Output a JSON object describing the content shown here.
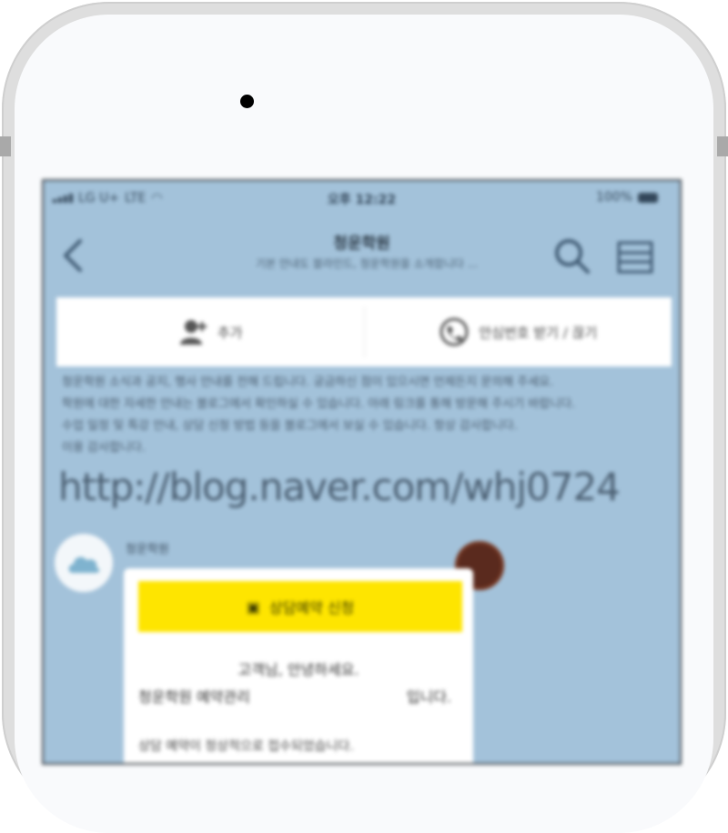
{
  "status": {
    "carrier": "LG U+",
    "network": "LTE",
    "time": "오후 12:22",
    "battery": "100%"
  },
  "header": {
    "title": "청운학원",
    "subtitle": "기본 안내도 블라인드, 청운학원을 소개합니다 ..."
  },
  "actions": {
    "add_friend": "추가",
    "safe_number": "안심번호 받기 / 끊기"
  },
  "chat": {
    "notice_lines": [
      "청운학원 소식과 공지, 행사 안내를 전해 드립니다. 궁금하신 점이 있으시면 언제든지 문의해 주세요.",
      "학원에 대한 자세한 안내는 블로그에서 확인하실 수 있습니다. 아래 링크를 통해 방문해 주시기 바랍니다.",
      "수업 일정 및 특강 안내, 상담 신청 방법 등을 블로그에서 보실 수 있습니다. 항상 감사합니다."
    ],
    "notice_last": "이용 감사합니다.",
    "link": "http://blog.naver.com/whj0724",
    "sender": "청운학원",
    "card": {
      "button_label": "상담예약 신청",
      "title": "고객님, 안녕하세요.",
      "row_left": "청운학원 예약관리",
      "row_right": "입니다.",
      "line": "상담 예약이 정상적으로 접수되었습니다."
    }
  },
  "colors": {
    "chat_bg": "#a3c2da",
    "button_yellow": "#fee500",
    "header_text": "#2d3b48"
  }
}
